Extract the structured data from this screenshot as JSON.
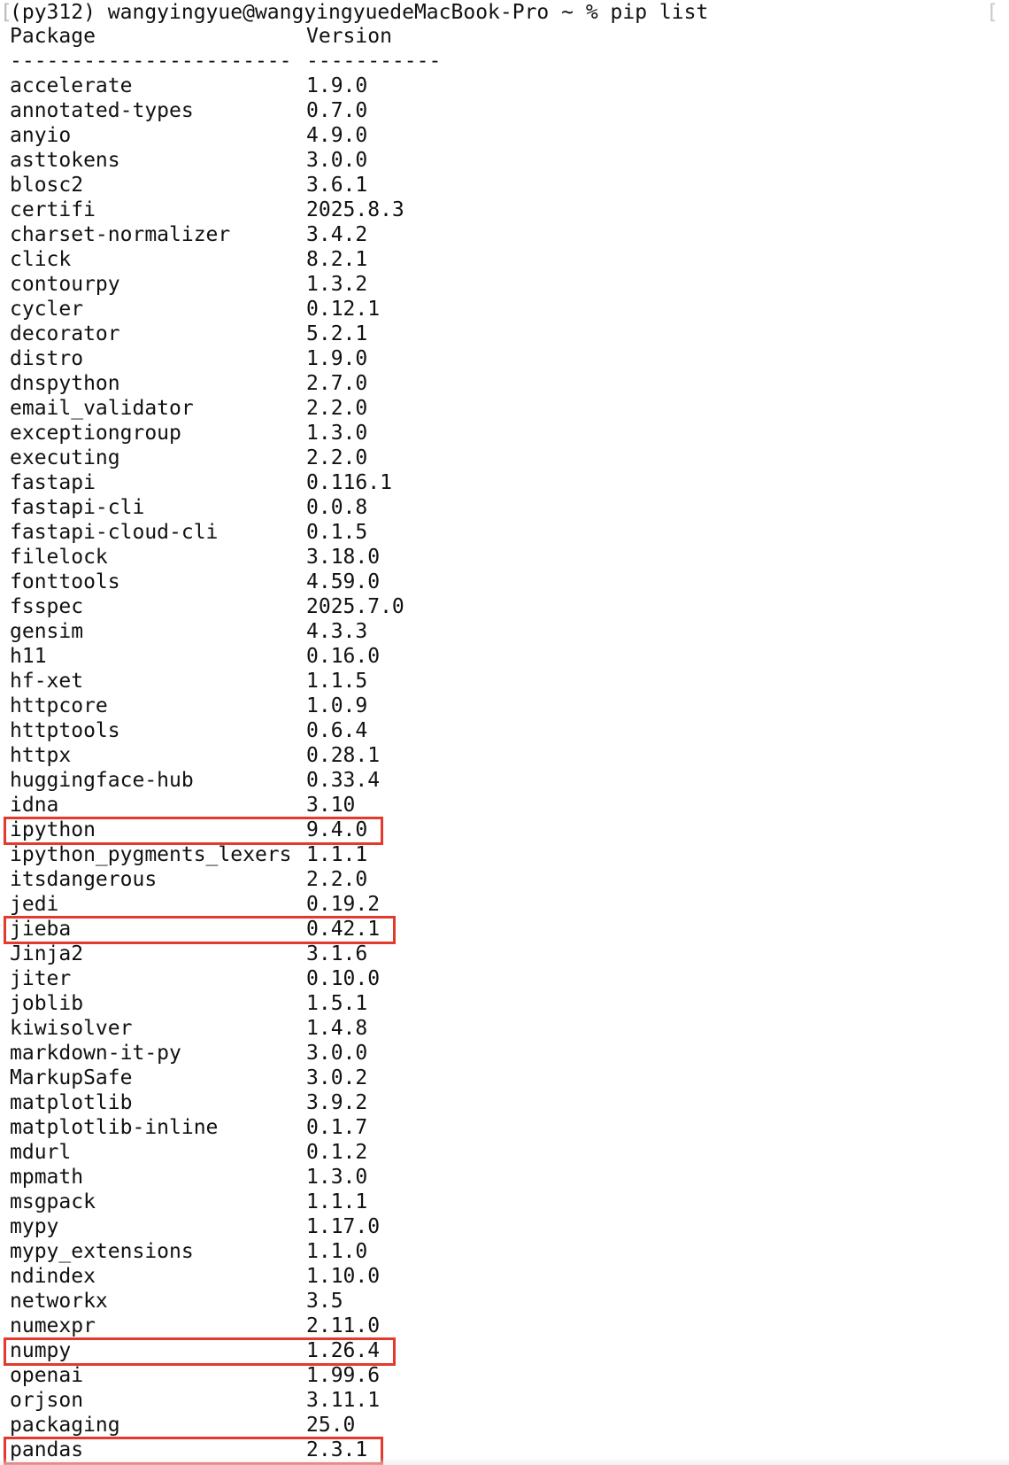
{
  "terminal": {
    "prompt": "(py312) wangyingyue@wangyingyuedeMacBook-Pro ~ % pip list",
    "bracket_left": "[",
    "bracket_right": "[",
    "header": {
      "package": "Package",
      "version": "Version"
    },
    "separator": {
      "package": "-----------------------",
      "version": "-----------"
    },
    "packages": [
      {
        "name": "accelerate",
        "version": "1.9.0"
      },
      {
        "name": "annotated-types",
        "version": "0.7.0"
      },
      {
        "name": "anyio",
        "version": "4.9.0"
      },
      {
        "name": "asttokens",
        "version": "3.0.0"
      },
      {
        "name": "blosc2",
        "version": "3.6.1"
      },
      {
        "name": "certifi",
        "version": "2025.8.3"
      },
      {
        "name": "charset-normalizer",
        "version": "3.4.2"
      },
      {
        "name": "click",
        "version": "8.2.1"
      },
      {
        "name": "contourpy",
        "version": "1.3.2"
      },
      {
        "name": "cycler",
        "version": "0.12.1"
      },
      {
        "name": "decorator",
        "version": "5.2.1"
      },
      {
        "name": "distro",
        "version": "1.9.0"
      },
      {
        "name": "dnspython",
        "version": "2.7.0"
      },
      {
        "name": "email_validator",
        "version": "2.2.0"
      },
      {
        "name": "exceptiongroup",
        "version": "1.3.0"
      },
      {
        "name": "executing",
        "version": "2.2.0"
      },
      {
        "name": "fastapi",
        "version": "0.116.1"
      },
      {
        "name": "fastapi-cli",
        "version": "0.0.8"
      },
      {
        "name": "fastapi-cloud-cli",
        "version": "0.1.5"
      },
      {
        "name": "filelock",
        "version": "3.18.0"
      },
      {
        "name": "fonttools",
        "version": "4.59.0"
      },
      {
        "name": "fsspec",
        "version": "2025.7.0"
      },
      {
        "name": "gensim",
        "version": "4.3.3"
      },
      {
        "name": "h11",
        "version": "0.16.0"
      },
      {
        "name": "hf-xet",
        "version": "1.1.5"
      },
      {
        "name": "httpcore",
        "version": "1.0.9"
      },
      {
        "name": "httptools",
        "version": "0.6.4"
      },
      {
        "name": "httpx",
        "version": "0.28.1"
      },
      {
        "name": "huggingface-hub",
        "version": "0.33.4"
      },
      {
        "name": "idna",
        "version": "3.10"
      },
      {
        "name": "ipython",
        "version": "9.4.0",
        "highlighted": true
      },
      {
        "name": "ipython_pygments_lexers",
        "version": "1.1.1"
      },
      {
        "name": "itsdangerous",
        "version": "2.2.0"
      },
      {
        "name": "jedi",
        "version": "0.19.2"
      },
      {
        "name": "jieba",
        "version": "0.42.1",
        "highlighted": true
      },
      {
        "name": "Jinja2",
        "version": "3.1.6"
      },
      {
        "name": "jiter",
        "version": "0.10.0"
      },
      {
        "name": "joblib",
        "version": "1.5.1"
      },
      {
        "name": "kiwisolver",
        "version": "1.4.8"
      },
      {
        "name": "markdown-it-py",
        "version": "3.0.0"
      },
      {
        "name": "MarkupSafe",
        "version": "3.0.2"
      },
      {
        "name": "matplotlib",
        "version": "3.9.2"
      },
      {
        "name": "matplotlib-inline",
        "version": "0.1.7"
      },
      {
        "name": "mdurl",
        "version": "0.1.2"
      },
      {
        "name": "mpmath",
        "version": "1.3.0"
      },
      {
        "name": "msgpack",
        "version": "1.1.1"
      },
      {
        "name": "mypy",
        "version": "1.17.0"
      },
      {
        "name": "mypy_extensions",
        "version": "1.1.0"
      },
      {
        "name": "ndindex",
        "version": "1.10.0"
      },
      {
        "name": "networkx",
        "version": "3.5"
      },
      {
        "name": "numexpr",
        "version": "2.11.0"
      },
      {
        "name": "numpy",
        "version": "1.26.4",
        "highlighted": true
      },
      {
        "name": "openai",
        "version": "1.99.6"
      },
      {
        "name": "orjson",
        "version": "3.11.1"
      },
      {
        "name": "packaging",
        "version": "25.0"
      },
      {
        "name": "pandas",
        "version": "2.3.1",
        "highlighted": true
      }
    ],
    "colors": {
      "text": "#111111",
      "background": "#ffffff",
      "highlight_border": "#e23a2e"
    }
  }
}
